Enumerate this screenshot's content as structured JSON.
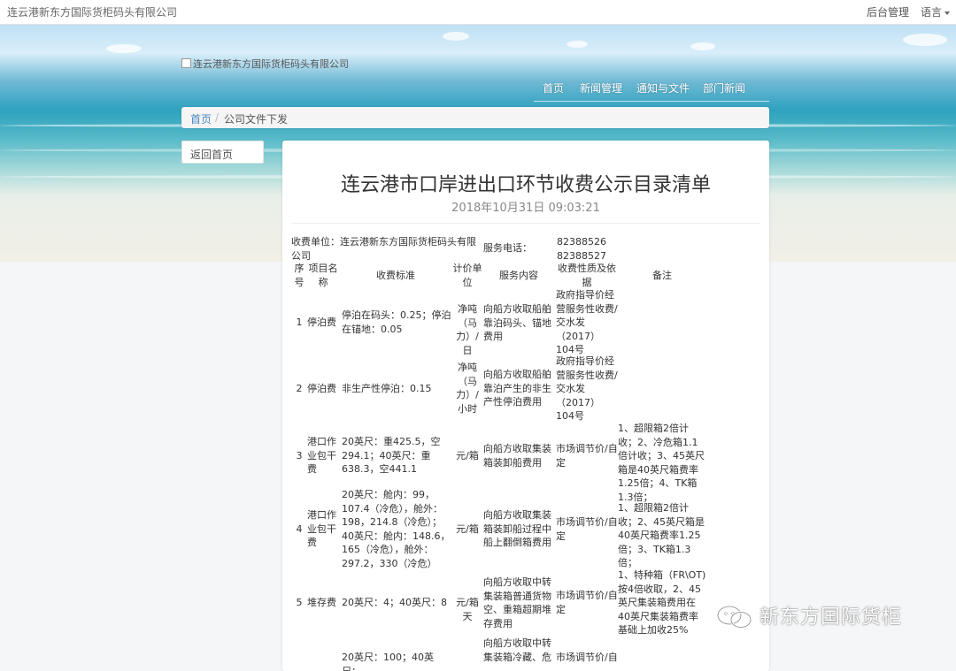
{
  "topbar": {
    "brand": "连云港新东方国际货柜码头有限公司",
    "admin": "后台管理",
    "language": "语言"
  },
  "logo": {
    "alt": "连云港新东方国际货柜码头有限公司"
  },
  "nav": [
    {
      "label": "首页"
    },
    {
      "label": "新闻管理"
    },
    {
      "label": "通知与文件"
    },
    {
      "label": "部门新闻"
    }
  ],
  "breadcrumb": {
    "home": "首页",
    "separator": "/",
    "current": "公司文件下发"
  },
  "back_button": "返回首页",
  "article": {
    "title": "连云港市口岸进出口环节收费公示目录清单",
    "date": "2018年10月31日 09:03:21"
  },
  "fee_table": {
    "unit_label": "收费单位：",
    "unit_name": "连云港新东方国际货柜码头有限公司",
    "phone_label": "服务电话：",
    "phones": [
      "82388526",
      "82388527"
    ],
    "headers": {
      "seq": "序号",
      "item": "项目名称",
      "standard": "收费标准",
      "unit": "计价单位",
      "content": "服务内容",
      "nature": "收费性质及依据",
      "remark": "备注"
    },
    "rows": [
      {
        "seq": "1",
        "item": "停泊费",
        "standard": "停泊在码头：0.25；停泊在锚地：0.05",
        "unit": "净吨（马力）/日",
        "content": "向船方收取船舶靠泊码头、锚地费用",
        "nature": "政府指导价经营服务性收费/交水发（2017）104号",
        "remark": ""
      },
      {
        "seq": "2",
        "item": "停泊费",
        "standard": "非生产性停泊：0.15",
        "unit": "净吨（马力）/小时",
        "content": "向船方收取船舶靠泊产生的非生产性停泊费用",
        "nature": "政府指导价经营服务性收费/交水发（2017）104号",
        "remark": ""
      },
      {
        "seq": "3",
        "item": "港口作业包干费",
        "standard": "20英尺：重425.5，空294.1；40英尺：重638.3，空441.1",
        "unit": "元/箱",
        "content": "向船方收取集装箱装卸船费用",
        "nature": "市场调节价/自定",
        "remark": "1、超限箱2倍计收；2、冷危箱1.1倍计收；3、45英尺箱是40英尺箱费率1.25倍；4、TK箱1.3倍；"
      },
      {
        "seq": "4",
        "item": "港口作业包干费",
        "standard": "20英尺：舱内：99，107.4（冷危），舱外：198，214.8（冷危）；40英尺：舱内：148.6，165（冷危），舱外：297.2，330（冷危）",
        "unit": "元/箱",
        "content": "向船方收取集装箱装卸船过程中船上翻倒箱费用",
        "nature": "市场调节价/自定",
        "remark": "1、超限箱2倍计收；2、45英尺箱是40英尺箱费率1.25倍；3、TK箱1.3倍；"
      },
      {
        "seq": "5",
        "item": "堆存费",
        "standard": "20英尺：4；40英尺：8",
        "unit": "元/箱天",
        "content": "向船方收取中转集装箱普通货物空、重箱超期堆存费用",
        "nature": "市场调节价/自定",
        "remark": "1、特种箱（FR\\OT)按4倍收取，2、45英尺集装箱费用在40英尺集装箱费率基础上加收25%"
      },
      {
        "seq": "",
        "item": "",
        "standard": "20英尺：100；40英尺：",
        "unit": "",
        "content": "向船方收取中转集装箱冷藏、危",
        "nature": "市场调节价/自",
        "remark": ""
      }
    ]
  },
  "watermark": {
    "text": "新东方国际货柜"
  },
  "colors": {
    "link": "#4a86c5",
    "panel_bg": "#ffffff",
    "page_bg": "#f5f6f7"
  }
}
